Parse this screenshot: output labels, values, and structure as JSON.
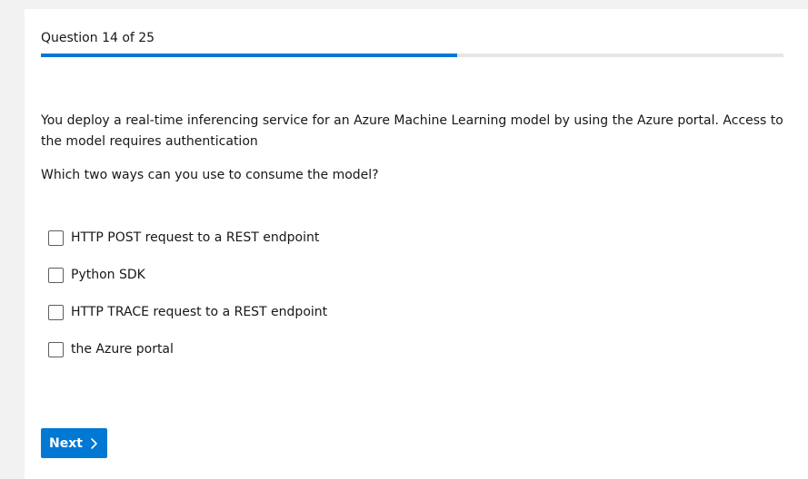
{
  "header": {
    "title": "Question 14 of 25"
  },
  "progress": {
    "fraction": 0.56,
    "fill_color": "#0078d4"
  },
  "question": {
    "text": "You deploy a real-time inferencing service for an Azure Machine Learning model by using the Azure portal. Access to the model requires authentication",
    "prompt": "Which two ways can you use to consume the model?"
  },
  "options": [
    {
      "label": "HTTP POST request to a REST endpoint",
      "checked": false
    },
    {
      "label": "Python SDK",
      "checked": false
    },
    {
      "label": "HTTP TRACE request to a REST endpoint",
      "checked": false
    },
    {
      "label": "the Azure portal",
      "checked": false
    }
  ],
  "actions": {
    "next_label": "Next",
    "next_icon": "chevron-right-icon",
    "accent_color": "#0078d4"
  }
}
